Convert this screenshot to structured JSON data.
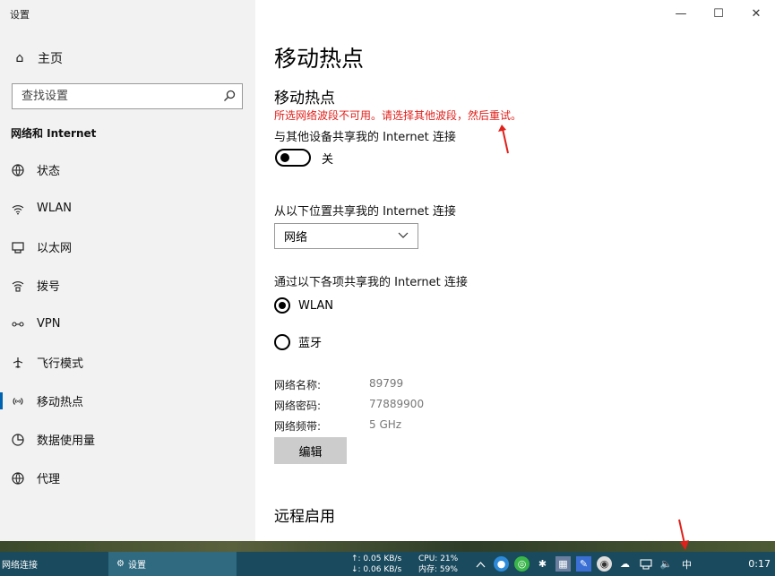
{
  "window": {
    "app_title": "设置",
    "controls": {
      "minimize": "—",
      "maximize": "☐",
      "close": "✕"
    }
  },
  "sidebar": {
    "home_label": "主页",
    "search_placeholder": "查找设置",
    "section_label": "网络和 Internet",
    "items": [
      {
        "label": "状态",
        "icon": "globe-icon"
      },
      {
        "label": "WLAN",
        "icon": "wifi-icon"
      },
      {
        "label": "以太网",
        "icon": "ethernet-icon"
      },
      {
        "label": "拨号",
        "icon": "dialup-icon"
      },
      {
        "label": "VPN",
        "icon": "vpn-icon"
      },
      {
        "label": "飞行模式",
        "icon": "airplane-icon"
      },
      {
        "label": "移动热点",
        "icon": "hotspot-icon",
        "active": true
      },
      {
        "label": "数据使用量",
        "icon": "data-usage-icon"
      },
      {
        "label": "代理",
        "icon": "proxy-globe-icon"
      }
    ]
  },
  "main": {
    "page_title": "移动热点",
    "subtitle": "移动热点",
    "error_message": "所选网络波段不可用。请选择其他波段，然后重试。",
    "share_label": "与其他设备共享我的 Internet 连接",
    "toggle_state": "关",
    "from_label": "从以下位置共享我的 Internet 连接",
    "from_value": "网络",
    "via_label": "通过以下各项共享我的 Internet 连接",
    "options": [
      {
        "label": "WLAN",
        "checked": true
      },
      {
        "label": "蓝牙",
        "checked": false
      }
    ],
    "details": [
      {
        "key": "网络名称:",
        "value": "89799"
      },
      {
        "key": "网络密码:",
        "value": "77889900"
      },
      {
        "key": "网络频带:",
        "value": "5 GHz"
      }
    ],
    "edit_label": "编辑",
    "remote_title": "远程启用"
  },
  "taskbar": {
    "network_label": "网络连接",
    "settings_label": "设置",
    "upload": "↑: 0.05 KB/s",
    "download": "↓: 0.06 KB/s",
    "cpu": "CPU: 21%",
    "memory": "内存: 59%",
    "ime": "中",
    "clock": "0:17"
  },
  "colors": {
    "accent": "#0063b1",
    "error": "#e0201b",
    "annotation": "#e0201b",
    "taskbar": "#1a4a5e"
  }
}
